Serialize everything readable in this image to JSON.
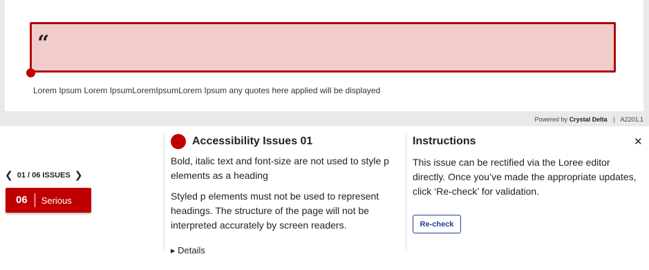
{
  "preview": {
    "quote_mark": "“",
    "caption": "Lorem Ipsum Lorem IpsumLoremIpsumLorem Ipsum any quotes here applied will be displayed",
    "powered_prefix": "Powered by",
    "powered_brand": "Crystal Delta",
    "separator": "|",
    "version": "A2201.1"
  },
  "issues_nav": {
    "counter": "01 / 06 ISSUES",
    "prev_icon": "chevron-left-icon",
    "next_icon": "chevron-right-icon"
  },
  "severity": {
    "count": "06",
    "label": "Serious",
    "color": "#c00000"
  },
  "issue": {
    "title": "Accessibility Issues 01",
    "paragraph1": "Bold, italic text and font-size are not used to style p elements as a heading",
    "paragraph2": "Styled p elements must not be used to represent headings. The structure of the page will not be interpreted accurately by screen readers.",
    "details_label": "Details"
  },
  "instructions": {
    "title": "Instructions",
    "text": "This issue can be rectified via the Loree editor directly. Once you’ve made the appropriate updates, click ‘Re-check’ for validation.",
    "recheck_label": "Re-check",
    "close_icon": "close-icon"
  },
  "colors": {
    "accent_red": "#c00000",
    "quote_bg": "#f1cccc",
    "link_blue": "#1f3f9c"
  }
}
